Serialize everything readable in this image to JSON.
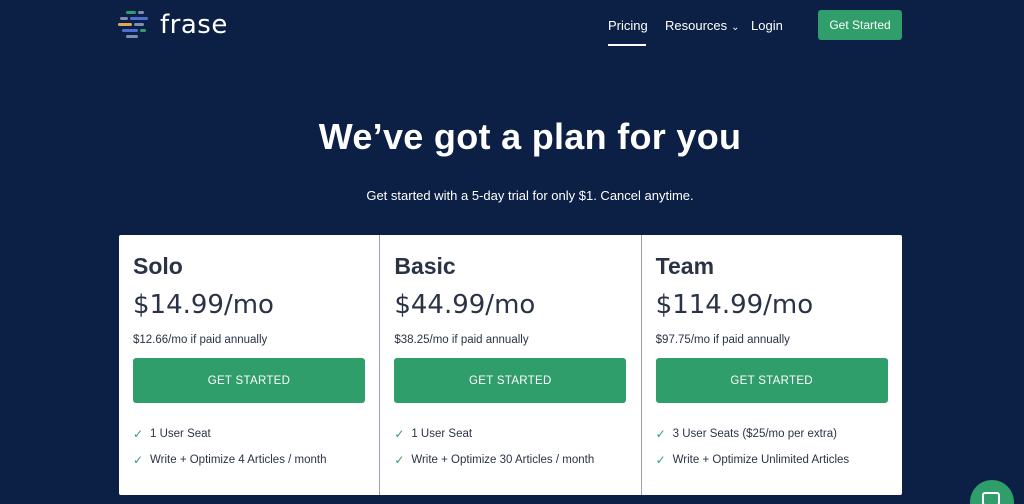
{
  "brand": {
    "logo_text": "frase",
    "logo_icon": "frase-logo-icon",
    "colors": {
      "background": "#0c1f45",
      "accent": "#2f9e6b"
    }
  },
  "nav": {
    "pricing": "Pricing",
    "resources": "Resources",
    "login": "Login",
    "cta": "Get Started"
  },
  "hero": {
    "title": "We’ve got a plan for you",
    "subtitle": "Get started with a 5-day trial for only $1. Cancel anytime."
  },
  "plans": [
    {
      "name": "Solo",
      "price": "$14.99/mo",
      "annual": "$12.66/mo if paid annually",
      "button": "GET STARTED",
      "features": [
        "1 User Seat",
        "Write + Optimize 4 Articles / month"
      ]
    },
    {
      "name": "Basic",
      "price": "$44.99/mo",
      "annual": "$38.25/mo if paid annually",
      "button": "GET STARTED",
      "features": [
        "1 User Seat",
        "Write + Optimize 30 Articles / month"
      ]
    },
    {
      "name": "Team",
      "price": "$114.99/mo",
      "annual": "$97.75/mo if paid annually",
      "button": "GET STARTED",
      "features": [
        "3 User Seats ($25/mo per extra)",
        "Write + Optimize Unlimited Articles"
      ]
    }
  ]
}
